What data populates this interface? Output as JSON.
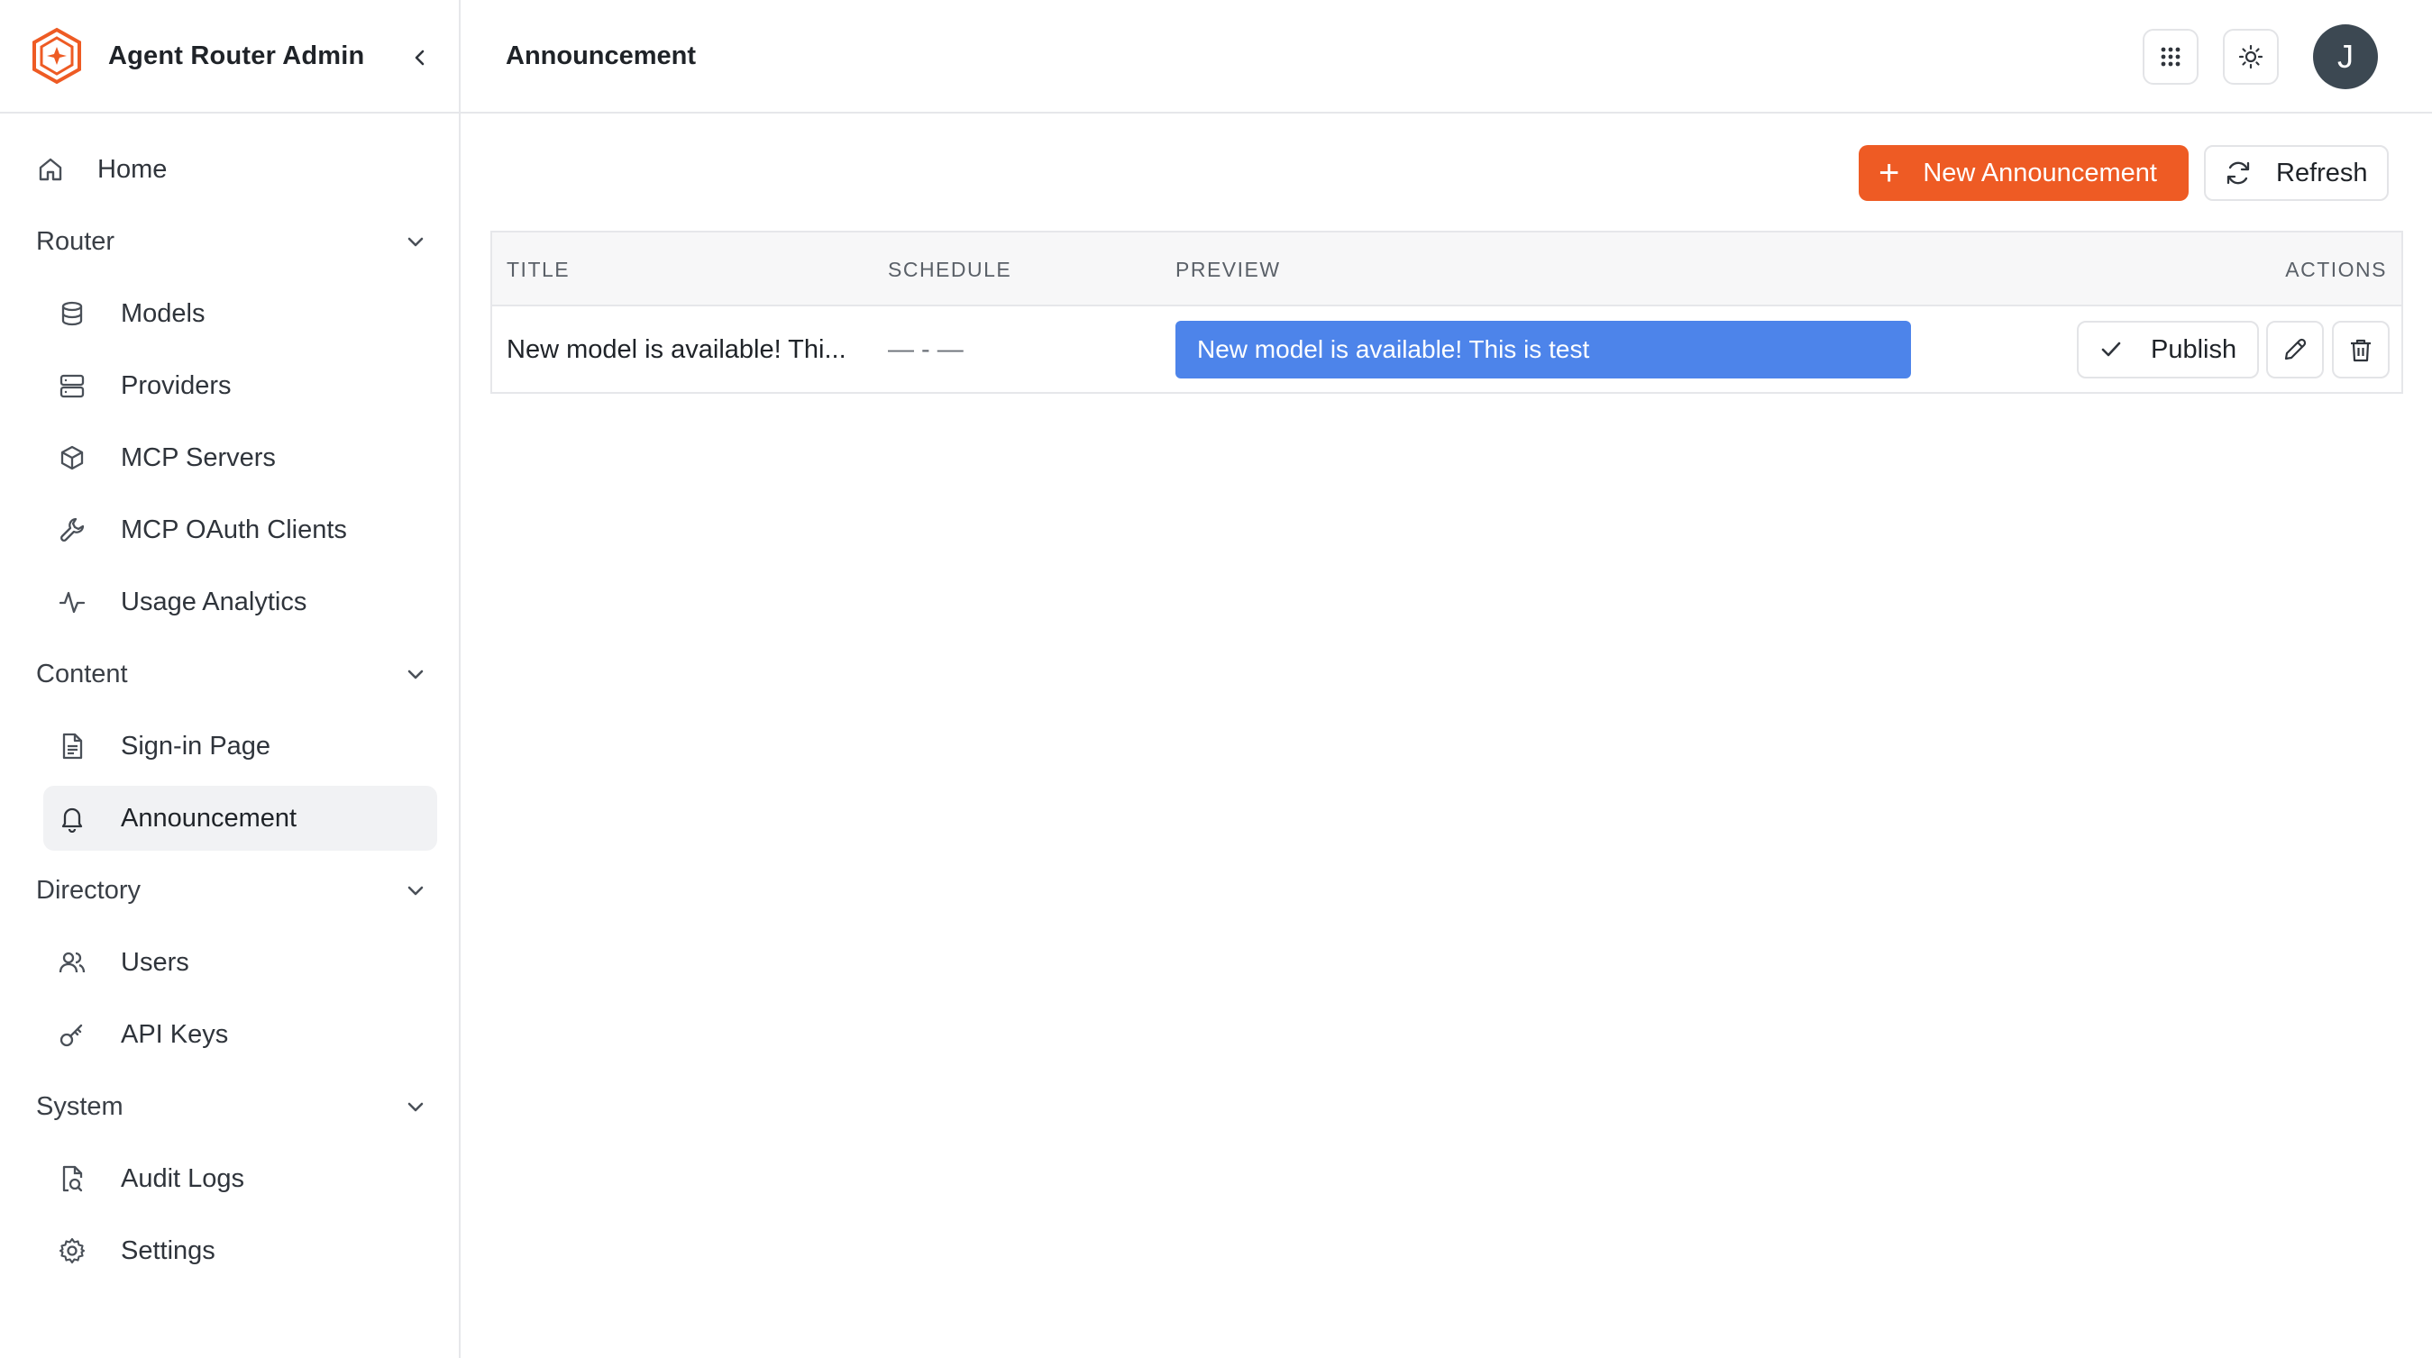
{
  "app": {
    "title": "Agent Router Admin"
  },
  "header": {
    "page_title": "Announcement",
    "avatar_initial": "J"
  },
  "sidebar": {
    "home": "Home",
    "groups": [
      {
        "label": "Router",
        "items": [
          "Models",
          "Providers",
          "MCP Servers",
          "MCP OAuth Clients",
          "Usage Analytics"
        ]
      },
      {
        "label": "Content",
        "items": [
          "Sign-in Page",
          "Announcement"
        ]
      },
      {
        "label": "Directory",
        "items": [
          "Users",
          "API Keys"
        ]
      },
      {
        "label": "System",
        "items": [
          "Audit Logs",
          "Settings"
        ]
      }
    ],
    "active_item": "Announcement"
  },
  "toolbar": {
    "new_label": "New Announcement",
    "refresh_label": "Refresh"
  },
  "table": {
    "columns": [
      "TITLE",
      "SCHEDULE",
      "PREVIEW",
      "ACTIONS"
    ],
    "rows": [
      {
        "title": "New model is available! Thi...",
        "schedule": "— - —",
        "preview": "New model is available! This is test",
        "publish_label": "Publish"
      }
    ]
  },
  "colors": {
    "accent": "#ee5b24",
    "preview": "#4d84ea",
    "avatar": "#3c4852"
  }
}
